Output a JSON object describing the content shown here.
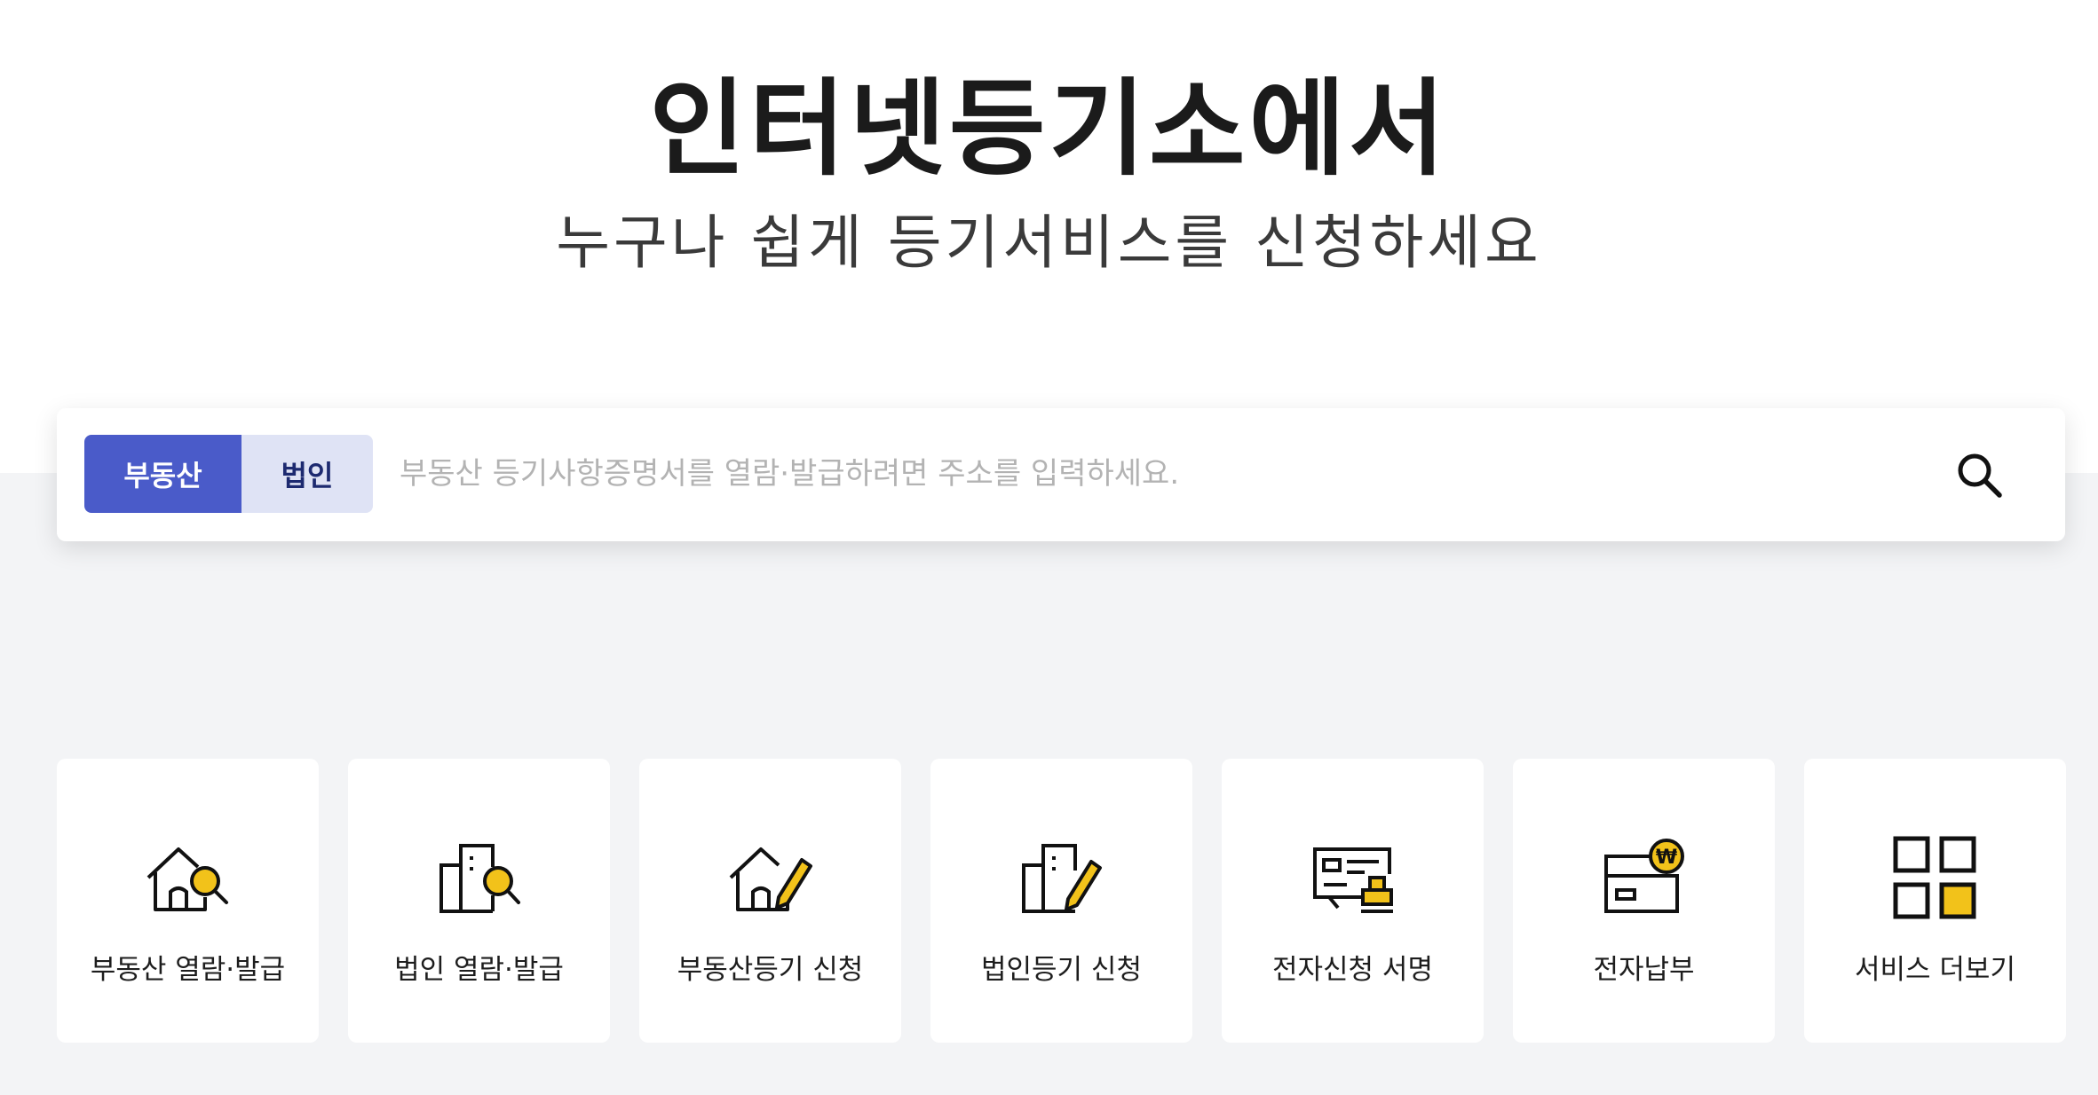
{
  "hero": {
    "title": "인터넷등기소에서",
    "subtitle": "누구나 쉽게 등기서비스를 신청하세요"
  },
  "search": {
    "tabs": [
      {
        "label": "부동산",
        "active": true
      },
      {
        "label": "법인",
        "active": false
      }
    ],
    "placeholder": "부동산 등기사항증명서를 열람·발급하려면 주소를 입력하세요.",
    "value": "",
    "button_icon": "search-icon"
  },
  "services": [
    {
      "label": "부동산 열람·발급",
      "icon": "house-search-icon"
    },
    {
      "label": "법인 열람·발급",
      "icon": "building-search-icon"
    },
    {
      "label": "부동산등기 신청",
      "icon": "house-pen-icon"
    },
    {
      "label": "법인등기 신청",
      "icon": "building-pen-icon"
    },
    {
      "label": "전자신청 서명",
      "icon": "certificate-stamp-icon"
    },
    {
      "label": "전자납부",
      "icon": "card-won-coin-icon"
    },
    {
      "label": "서비스 더보기",
      "icon": "grid-more-icon"
    }
  ],
  "colors": {
    "primary": "#4a5bc9",
    "tab_inactive_bg": "#dfe3f5",
    "accent_yellow": "#f2c21a",
    "background_gray": "#f3f4f6"
  }
}
